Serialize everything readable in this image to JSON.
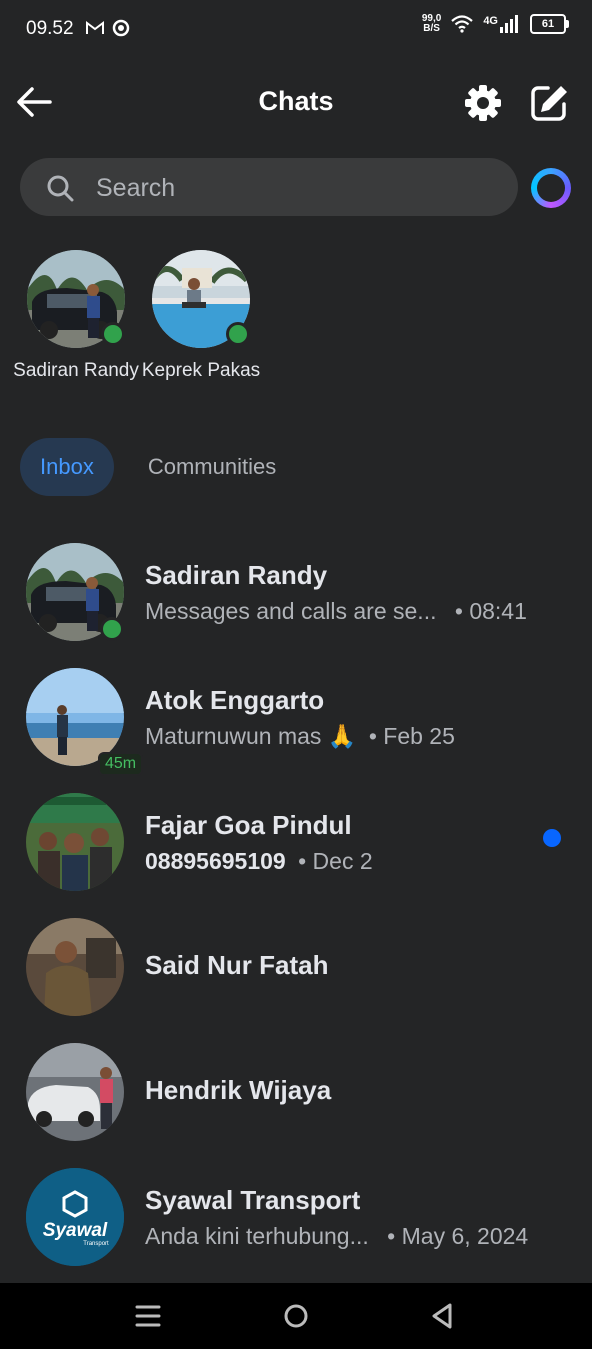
{
  "status_bar": {
    "time": "09.52",
    "speed_value": "99,0",
    "speed_unit": "B/S",
    "network": "4G",
    "battery": "61"
  },
  "header": {
    "title": "Chats"
  },
  "search": {
    "placeholder": "Search"
  },
  "active_contacts": [
    {
      "name": "Sadiran Randy"
    },
    {
      "name": "Keprek Pakas"
    }
  ],
  "tabs": [
    {
      "label": "Inbox",
      "active": true
    },
    {
      "label": "Communities",
      "active": false
    }
  ],
  "chats": [
    {
      "name": "Sadiran Randy",
      "preview": "Messages and calls are se...",
      "time": "• 08:41",
      "online": true
    },
    {
      "name": "Atok Enggarto",
      "preview": "Maturnuwun mas 🙏",
      "time": "• Feb 25",
      "badge": "45m"
    },
    {
      "name": "Fajar Goa Pindul",
      "preview": "08895695109",
      "time": "• Dec 2",
      "unread": true
    },
    {
      "name": "Said Nur Fatah"
    },
    {
      "name": "Hendrik Wijaya"
    },
    {
      "name": "Syawal Transport",
      "preview": "Anda kini terhubung...",
      "time": "• May 6, 2024",
      "logo_text": "Syawal",
      "logo_sub": "Transport"
    }
  ],
  "colors": {
    "background": "#242526",
    "accent": "#0866ff",
    "online": "#31a24c",
    "tab_active_bg": "#263951",
    "tab_active_text": "#4599ff"
  }
}
